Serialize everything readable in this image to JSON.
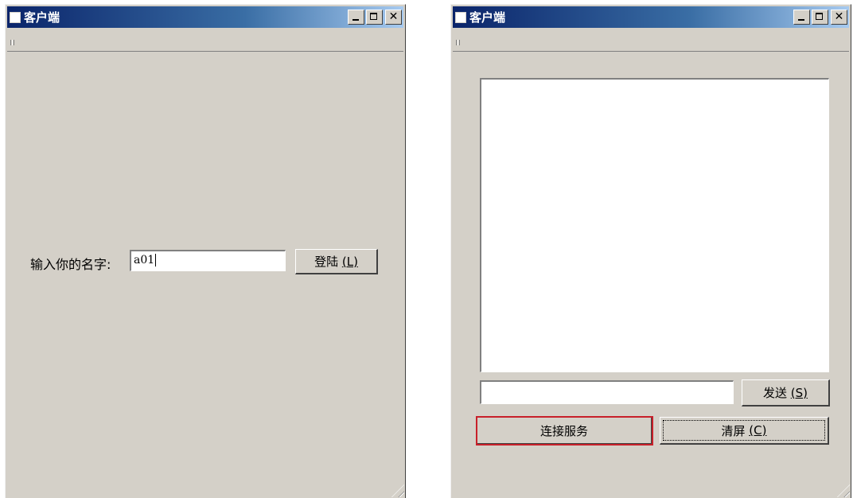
{
  "windows": [
    {
      "title": "客户端",
      "login": {
        "name_label": "输入你的名字:",
        "name_value": "a01",
        "login_button": "登陆",
        "login_mnemonic": "(L)"
      }
    },
    {
      "title": "客户端",
      "chat": {
        "message_area_value": "",
        "input_value": "",
        "send_button": "发送",
        "send_mnemonic": "(S)",
        "connect_button": "连接服务",
        "clear_button": "清屏",
        "clear_mnemonic": "(C)"
      }
    }
  ],
  "colors": {
    "title_gradient_start": "#0a246a",
    "title_gradient_end": "#a6caf0",
    "window_face": "#d4d0c8",
    "focus_outline": "#c8202a"
  },
  "icons": {
    "app": "window-icon",
    "minimize": "minimize-icon",
    "maximize": "maximize-icon",
    "close": "close-icon",
    "grip": "toolbar-grip-icon",
    "resize": "resize-grip-icon"
  }
}
